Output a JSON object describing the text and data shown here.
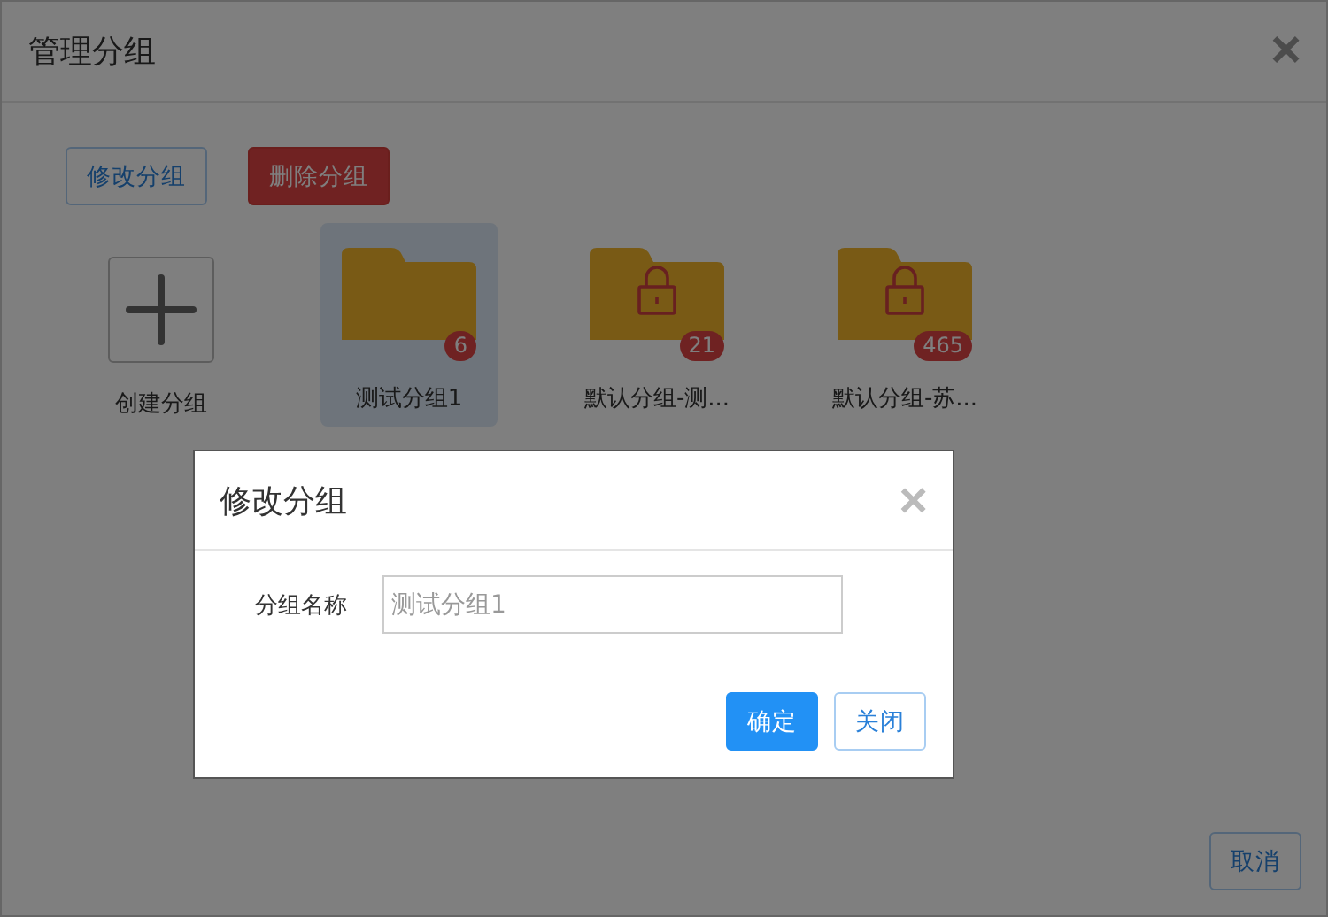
{
  "dialog": {
    "title": "管理分组",
    "close": "×"
  },
  "toolbar": [
    {
      "label": "修改分组",
      "kind": "outline"
    },
    {
      "label": "删除分组",
      "kind": "danger"
    }
  ],
  "groups": [
    {
      "kind": "create",
      "label": "创建分组",
      "selected": false
    },
    {
      "kind": "folder",
      "label": "测试分组1",
      "count": "6",
      "locked": false,
      "selected": true
    },
    {
      "kind": "folder",
      "label": "默认分组-测...",
      "count": "21",
      "locked": true,
      "selected": false
    },
    {
      "kind": "folder",
      "label": "默认分组-苏...",
      "count": "465",
      "locked": true,
      "selected": false
    }
  ],
  "footer": [
    {
      "label": "取消",
      "kind": "outline"
    }
  ],
  "modal": {
    "title": "修改分组",
    "close": "×",
    "fields": [
      {
        "label": "分组名称",
        "value": "测试分组1"
      }
    ],
    "buttons": [
      {
        "label": "确定",
        "kind": "primary"
      },
      {
        "label": "关闭",
        "kind": "outline"
      }
    ]
  }
}
